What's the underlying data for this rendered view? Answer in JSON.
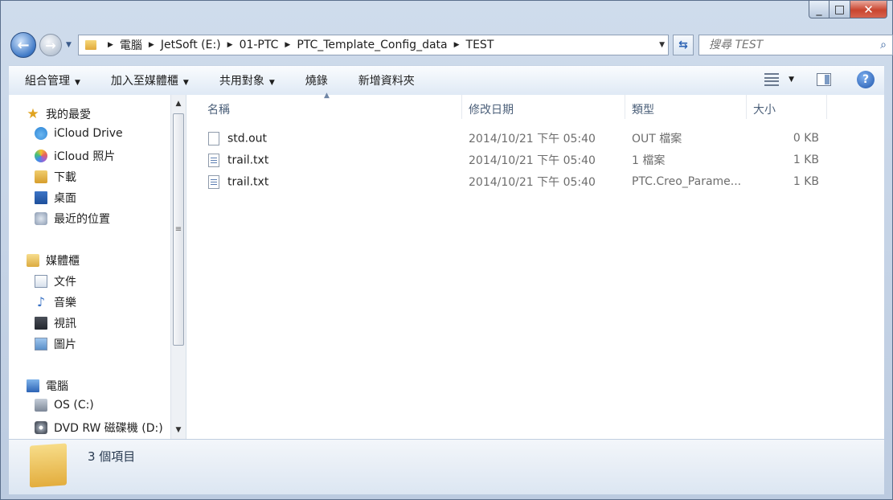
{
  "window": {
    "caption_buttons": {
      "minimize": "_",
      "maximize": "□",
      "close": "✕"
    }
  },
  "address": {
    "crumbs": [
      "電腦",
      "JetSoft (E:)",
      "01-PTC",
      "PTC_Template_Config_data",
      "TEST"
    ]
  },
  "search": {
    "placeholder": "搜尋 TEST"
  },
  "toolbar": {
    "organize": "組合管理",
    "include_library": "加入至媒體櫃",
    "share_with": "共用對象",
    "burn": "燒錄",
    "new_folder": "新增資料夾"
  },
  "nav": {
    "favorites": "我的最愛",
    "icloud_drive": "iCloud Drive",
    "icloud_photos": "iCloud 照片",
    "downloads": "下載",
    "desktop": "桌面",
    "recent": "最近的位置",
    "libraries": "媒體櫃",
    "documents": "文件",
    "music": "音樂",
    "videos": "視訊",
    "pictures": "圖片",
    "computer": "電腦",
    "os_drive": "OS (C:)",
    "dvd_drive": "DVD RW 磁碟機 (D:)"
  },
  "columns": {
    "name": "名稱",
    "date": "修改日期",
    "type": "類型",
    "size": "大小"
  },
  "files": [
    {
      "name": "std.out",
      "date": "2014/10/21 下午 05:40",
      "type": "OUT 檔案",
      "size": "0 KB"
    },
    {
      "name": "trail.txt",
      "date": "2014/10/21 下午 05:40",
      "type": "1 檔案",
      "size": "1 KB"
    },
    {
      "name": "trail.txt",
      "date": "2014/10/21 下午 05:40",
      "type": "PTC.Creo_Parame...",
      "size": "1 KB"
    }
  ],
  "status": {
    "item_count": "3 個項目"
  },
  "icons": {
    "back": "back-arrow-icon",
    "forward": "forward-arrow-icon",
    "refresh": "refresh-icon",
    "search": "magnifier-icon",
    "help": "help-icon",
    "folder": "folder-icon"
  }
}
